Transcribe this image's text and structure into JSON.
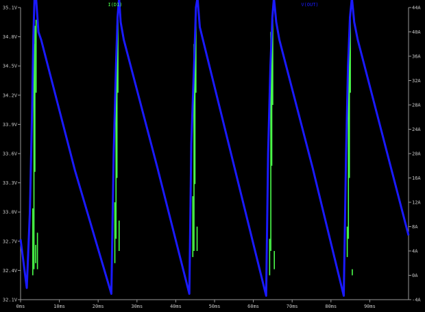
{
  "chart_data": {
    "type": "line",
    "title": "",
    "xlabel": "",
    "ylabel_left": "",
    "ylabel_right": "",
    "x_unit": "ms",
    "xlim": [
      0,
      100
    ],
    "ylim_left": [
      32.1,
      35.1
    ],
    "ylim_right": [
      -4,
      44
    ],
    "x_ticks": [
      0,
      10,
      20,
      30,
      40,
      50,
      60,
      70,
      80,
      90
    ],
    "x_tick_labels": [
      "0ms",
      "10ms",
      "20ms",
      "30ms",
      "40ms",
      "50ms",
      "60ms",
      "70ms",
      "80ms",
      "90ms"
    ],
    "y_ticks_left": [
      32.1,
      32.4,
      32.7,
      33.0,
      33.3,
      33.6,
      33.9,
      34.2,
      34.5,
      34.8,
      35.1
    ],
    "y_tick_labels_left": [
      "32.1V",
      "32.4V",
      "32.7V",
      "33.0V",
      "33.3V",
      "33.6V",
      "33.9V",
      "34.2V",
      "34.5V",
      "34.8V",
      "35.1V"
    ],
    "y_ticks_right": [
      -4,
      0,
      4,
      8,
      12,
      16,
      20,
      24,
      28,
      32,
      36,
      40,
      44
    ],
    "y_tick_labels_right": [
      "-4A",
      "0A",
      "4A",
      "8A",
      "12A",
      "16A",
      "20A",
      "24A",
      "28A",
      "32A",
      "36A",
      "40A",
      "44A"
    ],
    "grid": false,
    "colors": {
      "background": "#000000",
      "voltage": "#1a1aff",
      "current": "#4cff4c"
    },
    "series": [
      {
        "name": "V(OUT)",
        "axis": "left",
        "color": "#1a1aff",
        "x": [
          0,
          1.6,
          1.6,
          2.4,
          3.0,
          3.3,
          3.6,
          4.0,
          4.6,
          5.3,
          14.0,
          23.4,
          23.4,
          24.0,
          24.6,
          25.0,
          25.4,
          25.8,
          26.6,
          35.3,
          43.5,
          43.5,
          44.0,
          44.8,
          45.2,
          45.6,
          46.2,
          47.0,
          63.3,
          63.3,
          63.8,
          64.4,
          64.9,
          65.3,
          65.9,
          66.7,
          75.3,
          83.3,
          83.3,
          83.9,
          84.4,
          84.9,
          85.4,
          86.0,
          86.9,
          100
        ],
        "y": [
          32.72,
          32.22,
          32.22,
          33.0,
          34.1,
          34.8,
          35.2,
          35.2,
          34.85,
          34.77,
          33.43,
          32.16,
          32.16,
          33.6,
          34.5,
          35.0,
          35.2,
          34.95,
          34.77,
          33.45,
          32.16,
          32.16,
          33.7,
          34.6,
          35.1,
          35.2,
          34.9,
          34.77,
          32.14,
          32.14,
          33.6,
          34.5,
          35.0,
          35.2,
          34.95,
          34.77,
          33.45,
          32.14,
          32.14,
          33.6,
          34.5,
          35.0,
          35.2,
          34.95,
          34.77,
          32.76
        ]
      },
      {
        "name": "I(D1)",
        "axis": "right",
        "color": "#4cff4c",
        "segments": [
          {
            "x": 3.15,
            "y_from": 0,
            "y_to": 11
          },
          {
            "x": 3.45,
            "y_from": 1,
            "y_to": 38
          },
          {
            "x": 3.7,
            "y_from": 17,
            "y_to": 41
          },
          {
            "x": 4.0,
            "y_from": 30,
            "y_to": 42
          },
          {
            "x": 3.9,
            "y_from": 2,
            "y_to": 5
          },
          {
            "x": 4.35,
            "y_from": 1,
            "y_to": 7
          },
          {
            "x": 24.3,
            "y_from": 2,
            "y_to": 12
          },
          {
            "x": 24.6,
            "y_from": 6,
            "y_to": 36
          },
          {
            "x": 24.85,
            "y_from": 16,
            "y_to": 41
          },
          {
            "x": 25.1,
            "y_from": 30,
            "y_to": 42
          },
          {
            "x": 25.4,
            "y_from": 4,
            "y_to": 9
          },
          {
            "x": 44.4,
            "y_from": 3,
            "y_to": 13
          },
          {
            "x": 44.7,
            "y_from": 4,
            "y_to": 38
          },
          {
            "x": 44.95,
            "y_from": 15,
            "y_to": 41
          },
          {
            "x": 45.2,
            "y_from": 30,
            "y_to": 42
          },
          {
            "x": 45.5,
            "y_from": 4,
            "y_to": 8
          },
          {
            "x": 64.2,
            "y_from": 0,
            "y_to": 6
          },
          {
            "x": 64.5,
            "y_from": 4,
            "y_to": 40
          },
          {
            "x": 64.75,
            "y_from": 18,
            "y_to": 41
          },
          {
            "x": 65.0,
            "y_from": 28,
            "y_to": 42
          },
          {
            "x": 65.4,
            "y_from": 1,
            "y_to": 4
          },
          {
            "x": 84.2,
            "y_from": 3,
            "y_to": 8
          },
          {
            "x": 84.5,
            "y_from": 6,
            "y_to": 37
          },
          {
            "x": 84.75,
            "y_from": 16,
            "y_to": 41
          },
          {
            "x": 85.0,
            "y_from": 30,
            "y_to": 42
          },
          {
            "x": 85.5,
            "y_from": 0,
            "y_to": 1
          }
        ]
      }
    ]
  }
}
